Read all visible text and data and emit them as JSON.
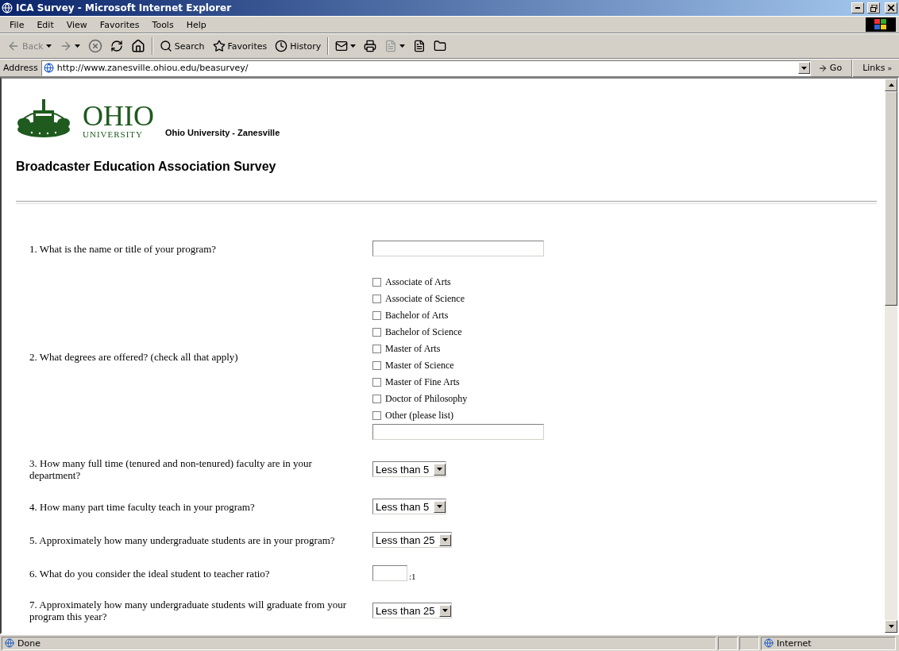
{
  "window": {
    "title": "ICA Survey - Microsoft Internet Explorer"
  },
  "menu": [
    "File",
    "Edit",
    "View",
    "Favorites",
    "Tools",
    "Help"
  ],
  "toolbar": {
    "back": "Back",
    "search": "Search",
    "favorites": "Favorites",
    "history": "History"
  },
  "address": {
    "label": "Address",
    "value": "http://www.zanesville.ohiou.edu/beasurvey/",
    "go": "Go",
    "links": "Links",
    "links_more": "»"
  },
  "page": {
    "logo_name": "OHIO",
    "logo_sub": "UNIVERSITY",
    "campus": "Ohio University - Zanesville",
    "heading": "Broadcaster Education Association Survey",
    "questions": [
      {
        "kind": "text",
        "label": "1. What is the name or title of your program?"
      },
      {
        "kind": "checkboxes",
        "label": "2. What degrees are offered? (check all that apply)",
        "options": [
          {
            "label": "Associate of Arts",
            "checked": false
          },
          {
            "label": "Associate of Science",
            "checked": false
          },
          {
            "label": "Bachelor of Arts",
            "checked": false
          },
          {
            "label": "Bachelor of Science",
            "checked": false
          },
          {
            "label": "Master of Arts",
            "checked": false
          },
          {
            "label": "Master of Science",
            "checked": false
          },
          {
            "label": "Master of Fine Arts",
            "checked": false
          },
          {
            "label": "Doctor of Philosophy",
            "checked": false
          },
          {
            "label": "Other (please list)",
            "checked": false
          }
        ]
      },
      {
        "kind": "select",
        "label": "3. How many full time (tenured and non-tenured) faculty are in your department?",
        "value": "Less than 5"
      },
      {
        "kind": "select",
        "label": "4. How many part time faculty teach in your program?",
        "value": "Less than 5"
      },
      {
        "kind": "select",
        "label": "5. Approximately how many undergraduate students are in your program?",
        "value": "Less than 25"
      },
      {
        "kind": "ratio",
        "label": "6. What do you consider the ideal student to teacher ratio?",
        "suffix": ":1"
      },
      {
        "kind": "select",
        "label": "7. Approximately how many undergraduate students will graduate from your program this year?",
        "value": "Less than 25"
      }
    ]
  },
  "status": {
    "text": "Done",
    "zone": "Internet"
  }
}
